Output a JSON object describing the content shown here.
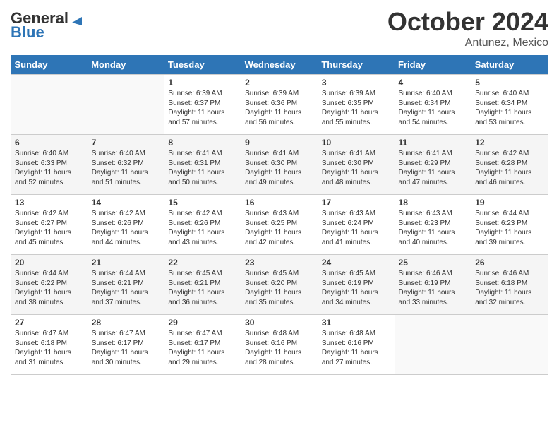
{
  "header": {
    "logo_general": "General",
    "logo_blue": "Blue",
    "title": "October 2024",
    "subtitle": "Antunez, Mexico"
  },
  "days_of_week": [
    "Sunday",
    "Monday",
    "Tuesday",
    "Wednesday",
    "Thursday",
    "Friday",
    "Saturday"
  ],
  "weeks": [
    [
      {
        "day": "",
        "content": ""
      },
      {
        "day": "",
        "content": ""
      },
      {
        "day": "1",
        "content": "Sunrise: 6:39 AM\nSunset: 6:37 PM\nDaylight: 11 hours and 57 minutes."
      },
      {
        "day": "2",
        "content": "Sunrise: 6:39 AM\nSunset: 6:36 PM\nDaylight: 11 hours and 56 minutes."
      },
      {
        "day": "3",
        "content": "Sunrise: 6:39 AM\nSunset: 6:35 PM\nDaylight: 11 hours and 55 minutes."
      },
      {
        "day": "4",
        "content": "Sunrise: 6:40 AM\nSunset: 6:34 PM\nDaylight: 11 hours and 54 minutes."
      },
      {
        "day": "5",
        "content": "Sunrise: 6:40 AM\nSunset: 6:34 PM\nDaylight: 11 hours and 53 minutes."
      }
    ],
    [
      {
        "day": "6",
        "content": "Sunrise: 6:40 AM\nSunset: 6:33 PM\nDaylight: 11 hours and 52 minutes."
      },
      {
        "day": "7",
        "content": "Sunrise: 6:40 AM\nSunset: 6:32 PM\nDaylight: 11 hours and 51 minutes."
      },
      {
        "day": "8",
        "content": "Sunrise: 6:41 AM\nSunset: 6:31 PM\nDaylight: 11 hours and 50 minutes."
      },
      {
        "day": "9",
        "content": "Sunrise: 6:41 AM\nSunset: 6:30 PM\nDaylight: 11 hours and 49 minutes."
      },
      {
        "day": "10",
        "content": "Sunrise: 6:41 AM\nSunset: 6:30 PM\nDaylight: 11 hours and 48 minutes."
      },
      {
        "day": "11",
        "content": "Sunrise: 6:41 AM\nSunset: 6:29 PM\nDaylight: 11 hours and 47 minutes."
      },
      {
        "day": "12",
        "content": "Sunrise: 6:42 AM\nSunset: 6:28 PM\nDaylight: 11 hours and 46 minutes."
      }
    ],
    [
      {
        "day": "13",
        "content": "Sunrise: 6:42 AM\nSunset: 6:27 PM\nDaylight: 11 hours and 45 minutes."
      },
      {
        "day": "14",
        "content": "Sunrise: 6:42 AM\nSunset: 6:26 PM\nDaylight: 11 hours and 44 minutes."
      },
      {
        "day": "15",
        "content": "Sunrise: 6:42 AM\nSunset: 6:26 PM\nDaylight: 11 hours and 43 minutes."
      },
      {
        "day": "16",
        "content": "Sunrise: 6:43 AM\nSunset: 6:25 PM\nDaylight: 11 hours and 42 minutes."
      },
      {
        "day": "17",
        "content": "Sunrise: 6:43 AM\nSunset: 6:24 PM\nDaylight: 11 hours and 41 minutes."
      },
      {
        "day": "18",
        "content": "Sunrise: 6:43 AM\nSunset: 6:23 PM\nDaylight: 11 hours and 40 minutes."
      },
      {
        "day": "19",
        "content": "Sunrise: 6:44 AM\nSunset: 6:23 PM\nDaylight: 11 hours and 39 minutes."
      }
    ],
    [
      {
        "day": "20",
        "content": "Sunrise: 6:44 AM\nSunset: 6:22 PM\nDaylight: 11 hours and 38 minutes."
      },
      {
        "day": "21",
        "content": "Sunrise: 6:44 AM\nSunset: 6:21 PM\nDaylight: 11 hours and 37 minutes."
      },
      {
        "day": "22",
        "content": "Sunrise: 6:45 AM\nSunset: 6:21 PM\nDaylight: 11 hours and 36 minutes."
      },
      {
        "day": "23",
        "content": "Sunrise: 6:45 AM\nSunset: 6:20 PM\nDaylight: 11 hours and 35 minutes."
      },
      {
        "day": "24",
        "content": "Sunrise: 6:45 AM\nSunset: 6:19 PM\nDaylight: 11 hours and 34 minutes."
      },
      {
        "day": "25",
        "content": "Sunrise: 6:46 AM\nSunset: 6:19 PM\nDaylight: 11 hours and 33 minutes."
      },
      {
        "day": "26",
        "content": "Sunrise: 6:46 AM\nSunset: 6:18 PM\nDaylight: 11 hours and 32 minutes."
      }
    ],
    [
      {
        "day": "27",
        "content": "Sunrise: 6:47 AM\nSunset: 6:18 PM\nDaylight: 11 hours and 31 minutes."
      },
      {
        "day": "28",
        "content": "Sunrise: 6:47 AM\nSunset: 6:17 PM\nDaylight: 11 hours and 30 minutes."
      },
      {
        "day": "29",
        "content": "Sunrise: 6:47 AM\nSunset: 6:17 PM\nDaylight: 11 hours and 29 minutes."
      },
      {
        "day": "30",
        "content": "Sunrise: 6:48 AM\nSunset: 6:16 PM\nDaylight: 11 hours and 28 minutes."
      },
      {
        "day": "31",
        "content": "Sunrise: 6:48 AM\nSunset: 6:16 PM\nDaylight: 11 hours and 27 minutes."
      },
      {
        "day": "",
        "content": ""
      },
      {
        "day": "",
        "content": ""
      }
    ]
  ]
}
